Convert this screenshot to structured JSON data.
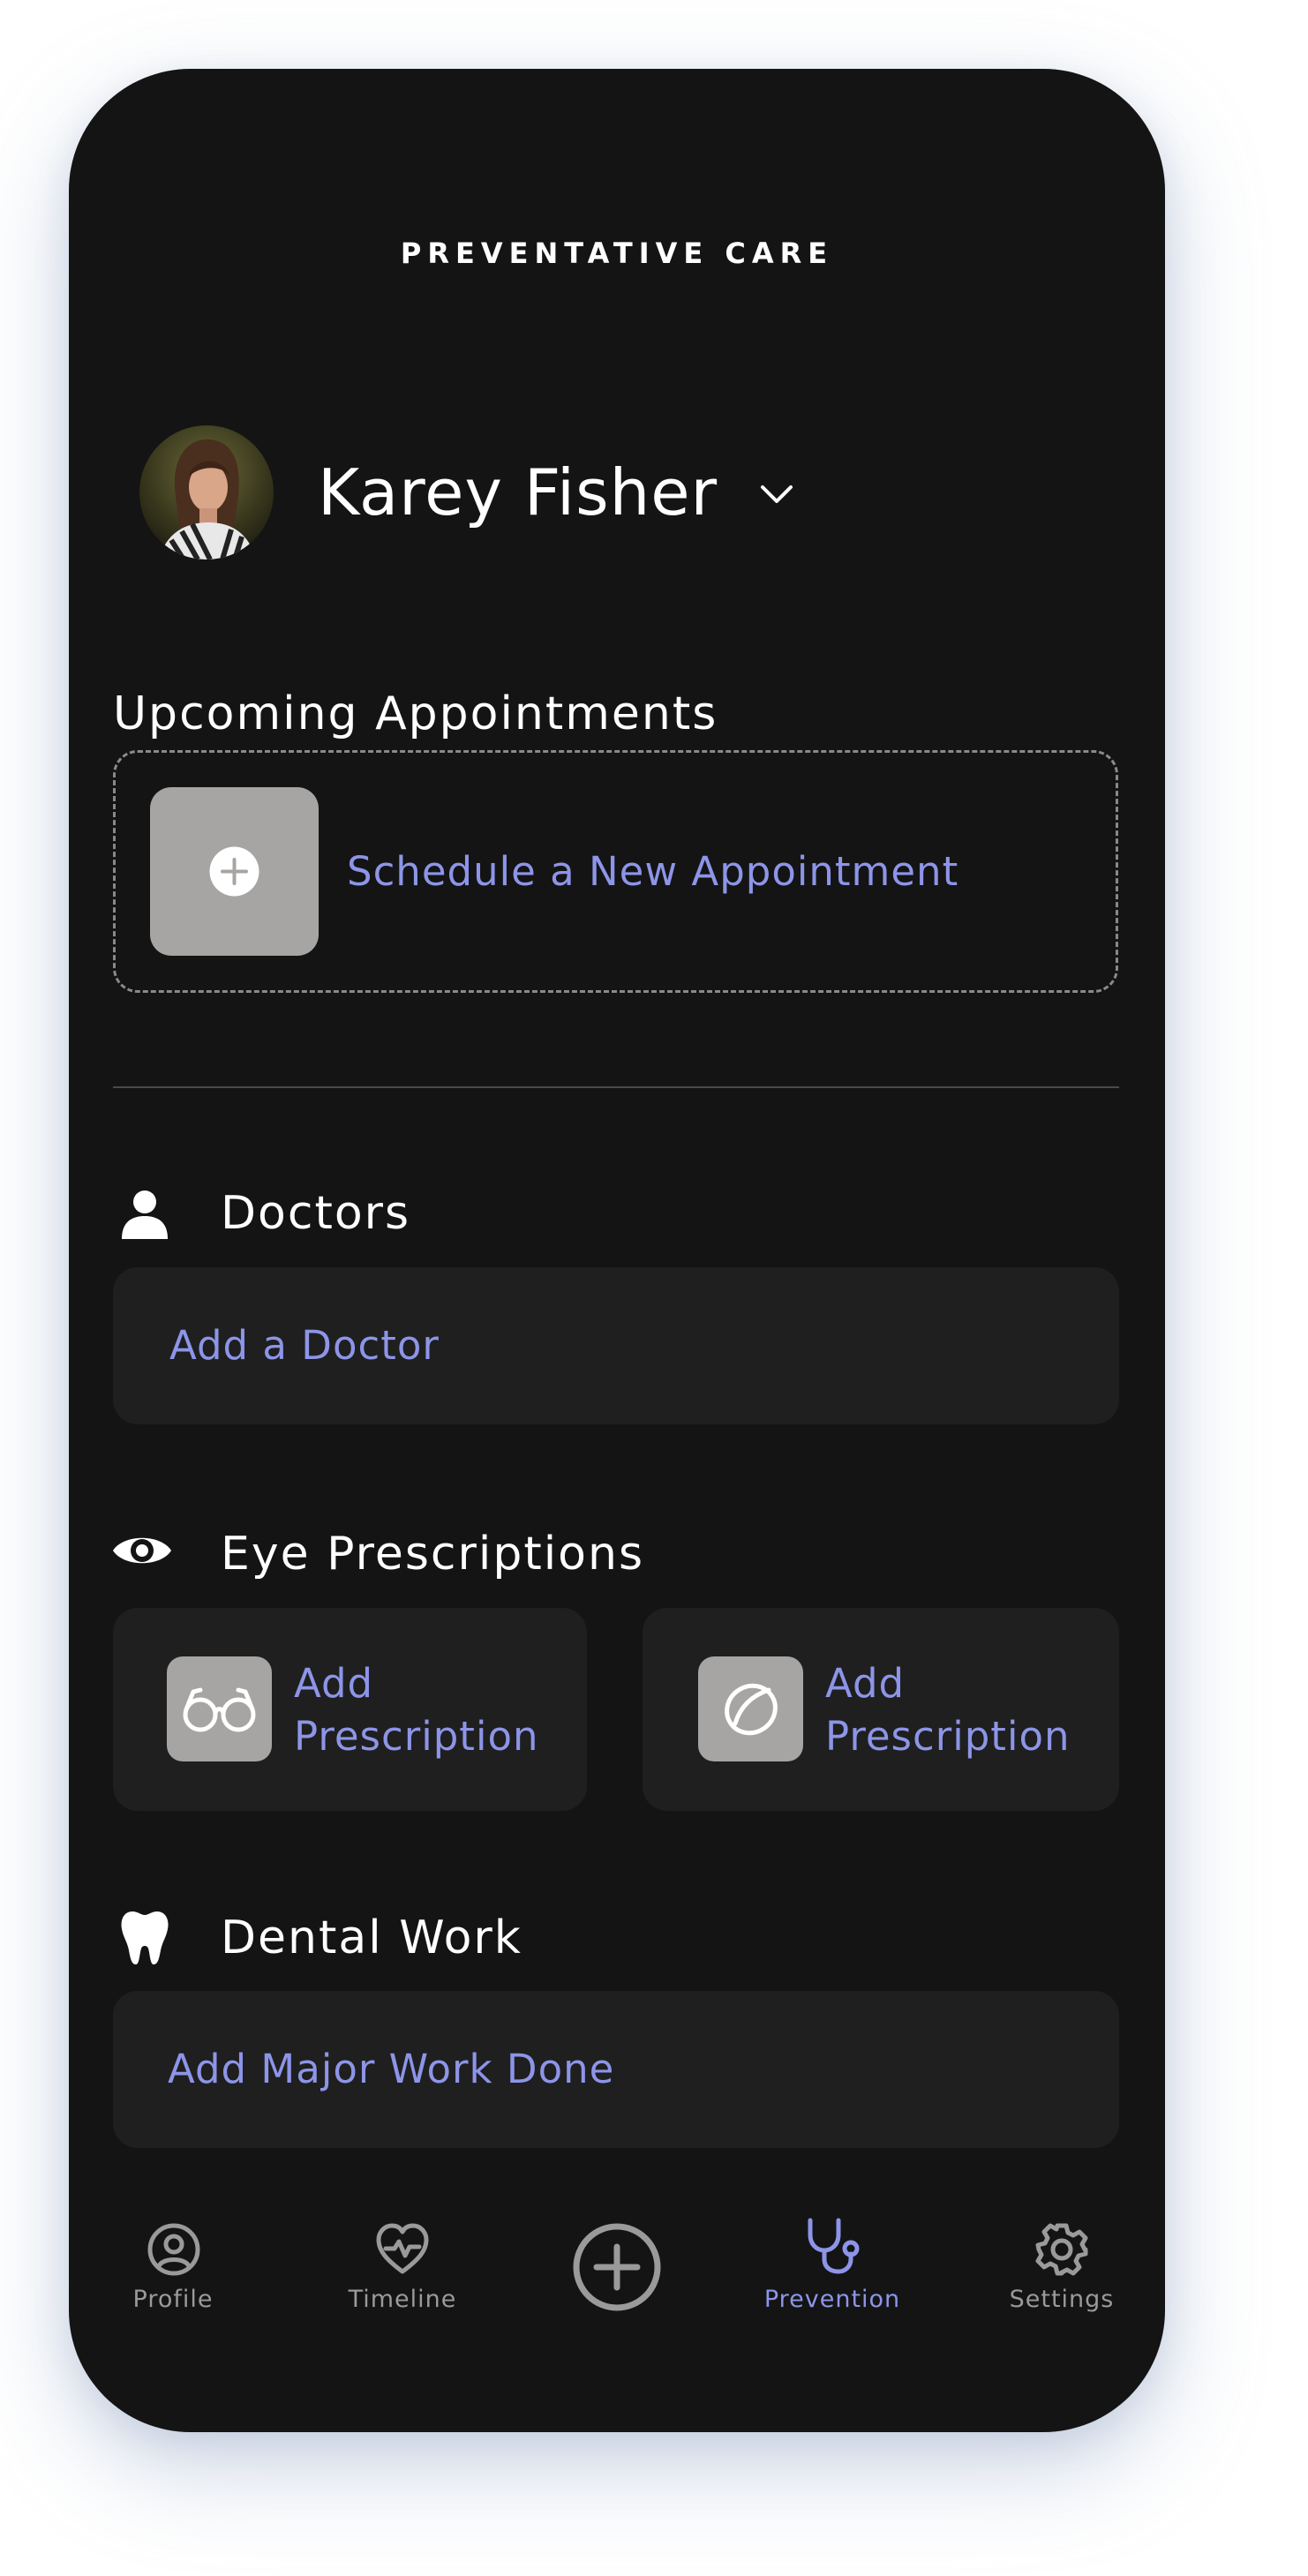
{
  "header": {
    "title": "PREVENTATIVE CARE"
  },
  "user": {
    "name": "Karey Fisher"
  },
  "appointments": {
    "title": "Upcoming Appointments",
    "action_label": "Schedule a New Appointment"
  },
  "doctors": {
    "title": "Doctors",
    "action_label": "Add a Doctor"
  },
  "eye": {
    "title": "Eye Prescriptions",
    "glasses_label": "Add Prescription",
    "contacts_label": "Add Prescription"
  },
  "dental": {
    "title": "Dental Work",
    "action_label": "Add Major Work Done"
  },
  "tabbar": {
    "items": [
      {
        "label": "Profile",
        "icon": "profile-icon"
      },
      {
        "label": "Timeline",
        "icon": "heart-pulse-icon"
      },
      {
        "label": "",
        "icon": "add-circle-icon"
      },
      {
        "label": "Prevention",
        "icon": "stethoscope-icon"
      },
      {
        "label": "Settings",
        "icon": "gear-icon"
      }
    ],
    "active": "Prevention"
  },
  "colors": {
    "background": "#141414",
    "card": "#1f1f1f",
    "accent": "#8d95e8",
    "tile": "#a7a5a3",
    "inactive": "#9a9a9a"
  }
}
